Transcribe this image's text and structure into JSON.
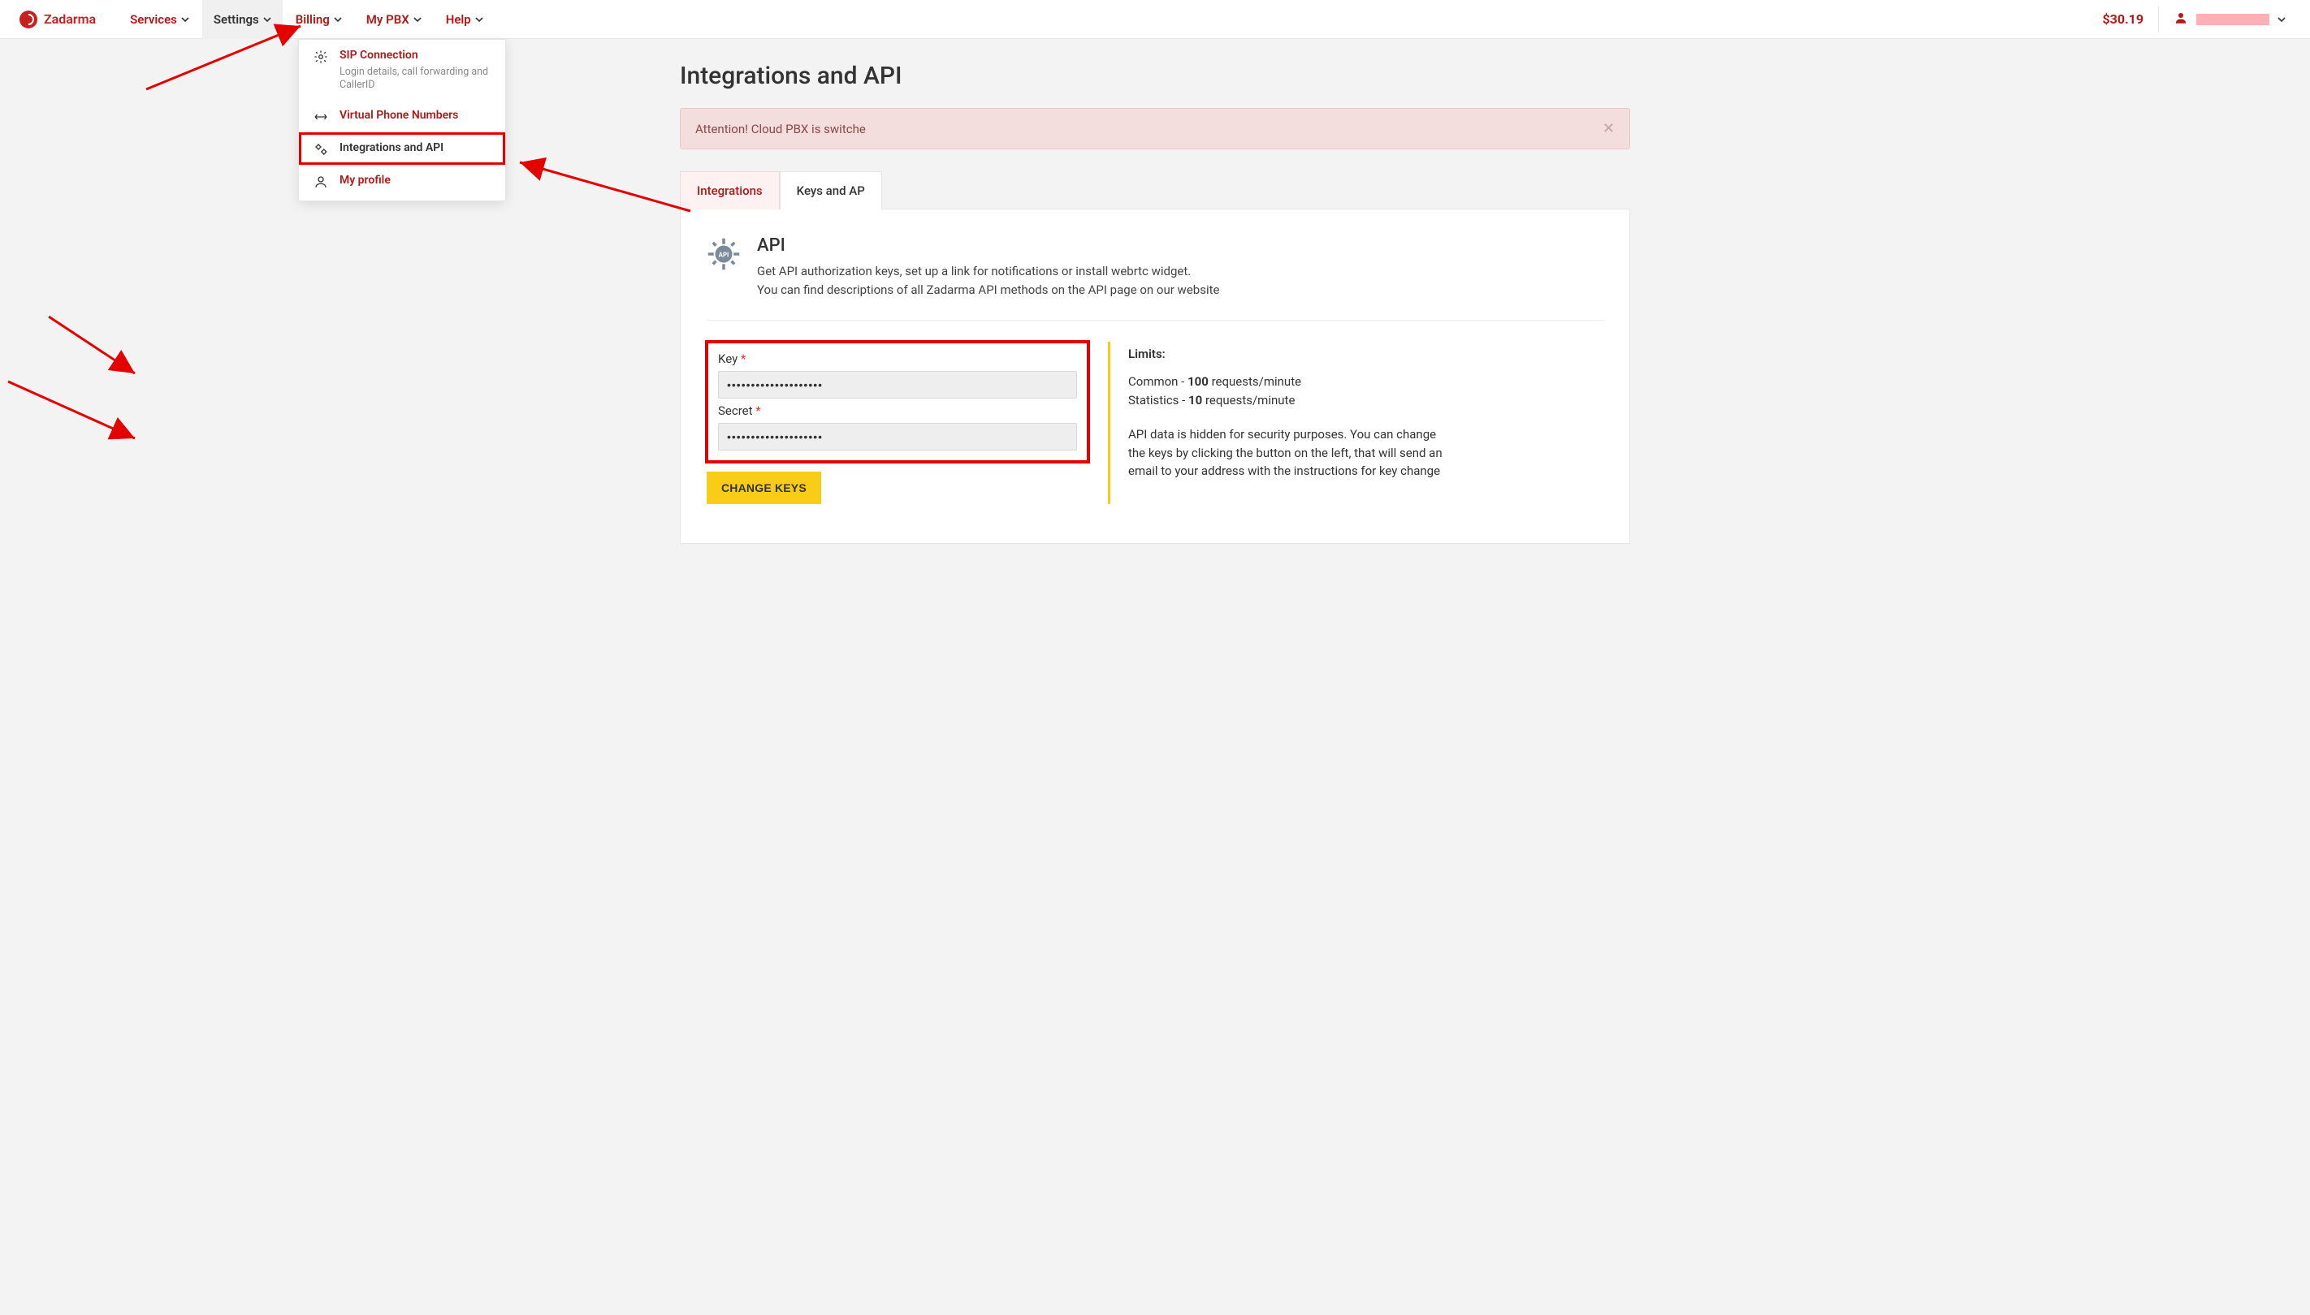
{
  "brand": "Zadarma",
  "nav": {
    "services": "Services",
    "settings": "Settings",
    "billing": "Billing",
    "mypbx": "My PBX",
    "help": "Help"
  },
  "balance": "$30.19",
  "dropdown": {
    "sip": {
      "title": "SIP Connection",
      "sub": "Login details, call forwarding and CallerID"
    },
    "virtual": {
      "title": "Virtual Phone Numbers"
    },
    "integrations": {
      "title": "Integrations and API"
    },
    "profile": {
      "title": "My profile"
    }
  },
  "page_title": "Integrations and API",
  "alert": {
    "text": "Attention! Cloud PBX is switche"
  },
  "tabs": {
    "integrations": "Integrations",
    "keys": "Keys and AP"
  },
  "api": {
    "title": "API",
    "desc1": "Get API authorization keys, set up a link for notifications or install webrtc widget.",
    "desc2": "You can find descriptions of all Zadarma API methods on the API page on our website"
  },
  "form": {
    "key_label": "Key",
    "key_value": "••••••••••••••••••••",
    "secret_label": "Secret",
    "secret_value": "••••••••••••••••••••",
    "button": "CHANGE KEYS"
  },
  "limits": {
    "title": "Limits:",
    "common_label": "Common - ",
    "common_value": "100",
    "common_suffix": " requests/minute",
    "stats_label": "Statistics - ",
    "stats_value": "10",
    "stats_suffix": " requests/minute",
    "note": "API data is hidden for security purposes. You can change the keys by clicking the button on the left, that will send an email to your address with the instructions for key change"
  }
}
